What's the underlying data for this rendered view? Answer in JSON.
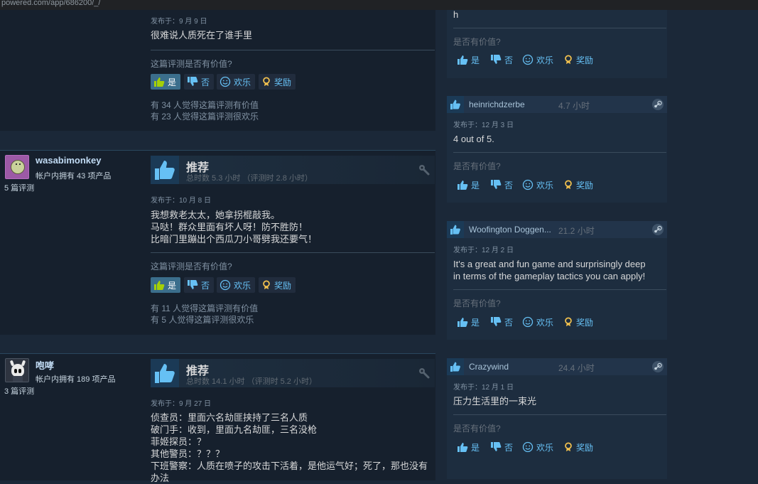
{
  "browser": {
    "url": "powered.com/app/686200/_/"
  },
  "colors": {
    "background": "#1b2838",
    "panel": "#16202d",
    "accent": "#66c0f4",
    "active_button": "#3b6e8c"
  },
  "left_reviews": [
    {
      "posted": "发布于：9 月 9 日",
      "text": [
        "很难说人质死在了谁手里"
      ],
      "helpful_question": "这篇评测是否有价值?",
      "buttons": {
        "yes": "是",
        "no": "否",
        "funny": "欢乐",
        "award": "奖励"
      },
      "tally": [
        "有 34 人觉得这篇评测有价值",
        "有 23 人觉得这篇评测很欢乐"
      ]
    },
    {
      "user": {
        "name": "wasabimonkey",
        "products": "帐户内拥有 43 项产品",
        "reviews": "5 篇评测"
      },
      "verdict": "推荐",
      "hours": "总时数 5.3 小时 （评测时 2.8 小时）",
      "posted": "发布于：10 月 8 日",
      "text": [
        "我想救老太太，她拿拐棍敲我。",
        "马哒！群众里面有坏人呀！防不胜防！",
        "比暗门里蹦出个西瓜刀小哥劈我还要气！"
      ],
      "helpful_question": "这篇评测是否有价值?",
      "buttons": {
        "yes": "是",
        "no": "否",
        "funny": "欢乐",
        "award": "奖励"
      },
      "tally": [
        "有 11 人觉得这篇评测有价值",
        "有 5 人觉得这篇评测很欢乐"
      ]
    },
    {
      "user": {
        "name": "咆哮",
        "products": "帐户内拥有 189 项产品",
        "reviews": "3 篇评测"
      },
      "verdict": "推荐",
      "hours": "总时数 14.1 小时 （评测时 5.2 小时）",
      "posted": "发布于：9 月 27 日",
      "text": [
        "侦查员：里面六名劫匪挟持了三名人质",
        "破门手：收到，里面九名劫匪，三名没枪",
        "菲姬探员：？",
        "其他警员：？？？",
        "下班警察：人质在喷子的攻击下活着，是他运气好；死了，那也没有",
        "办法"
      ]
    }
  ],
  "right_reviews": [
    {
      "text": [
        "h"
      ],
      "helpful_question": "是否有价值?",
      "buttons": {
        "yes": "是",
        "no": "否",
        "funny": "欢乐",
        "award": "奖励"
      }
    },
    {
      "name": "heinrichdzerbe",
      "hours": "4.7 小时",
      "posted": "发布于：12 月 3 日",
      "text": [
        "4 out of 5."
      ],
      "helpful_question": "是否有价值?",
      "buttons": {
        "yes": "是",
        "no": "否",
        "funny": "欢乐",
        "award": "奖励"
      }
    },
    {
      "name": "Woofington Doggen...",
      "hours": "21.2 小时",
      "posted": "发布于：12 月 2 日",
      "text": [
        "It's a great and fun game and surprisingly deep",
        "in terms of the gameplay tactics you can apply!"
      ],
      "helpful_question": "是否有价值?",
      "buttons": {
        "yes": "是",
        "no": "否",
        "funny": "欢乐",
        "award": "奖励"
      }
    },
    {
      "name": "Crazywind",
      "hours": "24.4 小时",
      "posted": "发布于：12 月 1 日",
      "text": [
        "压力生活里的一束光"
      ],
      "helpful_question": "是否有价值?",
      "buttons": {
        "yes": "是",
        "no": "否",
        "funny": "欢乐",
        "award": "奖励"
      }
    }
  ]
}
